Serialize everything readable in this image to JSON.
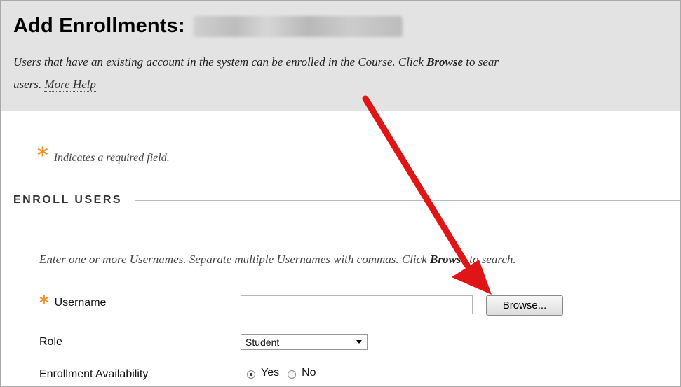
{
  "header": {
    "title": "Add Enrollments:",
    "instructions_pre": "Users that have an existing account in the system can be enrolled in the Course. Click ",
    "instructions_bold": "Browse",
    "instructions_post": " to sear",
    "instructions_line2": "users. ",
    "more_help": "More Help"
  },
  "required_note": "Indicates a required field.",
  "section": {
    "title": "ENROLL USERS"
  },
  "enroll": {
    "help_pre": "Enter one or more Usernames. Separate multiple Usernames with commas. Click ",
    "help_bold": "Browse",
    "help_post": " to search.",
    "username_label": "Username",
    "username_value": "",
    "browse_button": "Browse...",
    "role_label": "Role",
    "role_selected": "Student",
    "availability_label": "Enrollment Availability",
    "yes_label": "Yes",
    "no_label": "No",
    "availability_selected": "Yes"
  },
  "colors": {
    "header_bg": "#e3e3e3",
    "asterisk": "#f0912a",
    "arrow": "#e01515"
  },
  "icons": {
    "required": "asterisk-icon",
    "annotation": "red-arrow-icon"
  }
}
